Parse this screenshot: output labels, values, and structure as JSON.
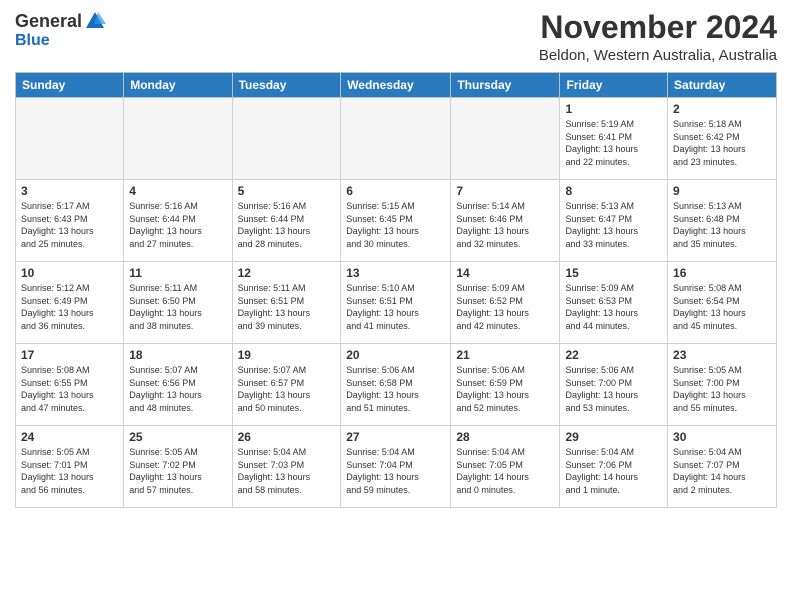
{
  "header": {
    "logo_general": "General",
    "logo_blue": "Blue",
    "month_title": "November 2024",
    "location": "Beldon, Western Australia, Australia"
  },
  "days_of_week": [
    "Sunday",
    "Monday",
    "Tuesday",
    "Wednesday",
    "Thursday",
    "Friday",
    "Saturday"
  ],
  "weeks": [
    [
      {
        "day": "",
        "info": ""
      },
      {
        "day": "",
        "info": ""
      },
      {
        "day": "",
        "info": ""
      },
      {
        "day": "",
        "info": ""
      },
      {
        "day": "",
        "info": ""
      },
      {
        "day": "1",
        "info": "Sunrise: 5:19 AM\nSunset: 6:41 PM\nDaylight: 13 hours\nand 22 minutes."
      },
      {
        "day": "2",
        "info": "Sunrise: 5:18 AM\nSunset: 6:42 PM\nDaylight: 13 hours\nand 23 minutes."
      }
    ],
    [
      {
        "day": "3",
        "info": "Sunrise: 5:17 AM\nSunset: 6:43 PM\nDaylight: 13 hours\nand 25 minutes."
      },
      {
        "day": "4",
        "info": "Sunrise: 5:16 AM\nSunset: 6:44 PM\nDaylight: 13 hours\nand 27 minutes."
      },
      {
        "day": "5",
        "info": "Sunrise: 5:16 AM\nSunset: 6:44 PM\nDaylight: 13 hours\nand 28 minutes."
      },
      {
        "day": "6",
        "info": "Sunrise: 5:15 AM\nSunset: 6:45 PM\nDaylight: 13 hours\nand 30 minutes."
      },
      {
        "day": "7",
        "info": "Sunrise: 5:14 AM\nSunset: 6:46 PM\nDaylight: 13 hours\nand 32 minutes."
      },
      {
        "day": "8",
        "info": "Sunrise: 5:13 AM\nSunset: 6:47 PM\nDaylight: 13 hours\nand 33 minutes."
      },
      {
        "day": "9",
        "info": "Sunrise: 5:13 AM\nSunset: 6:48 PM\nDaylight: 13 hours\nand 35 minutes."
      }
    ],
    [
      {
        "day": "10",
        "info": "Sunrise: 5:12 AM\nSunset: 6:49 PM\nDaylight: 13 hours\nand 36 minutes."
      },
      {
        "day": "11",
        "info": "Sunrise: 5:11 AM\nSunset: 6:50 PM\nDaylight: 13 hours\nand 38 minutes."
      },
      {
        "day": "12",
        "info": "Sunrise: 5:11 AM\nSunset: 6:51 PM\nDaylight: 13 hours\nand 39 minutes."
      },
      {
        "day": "13",
        "info": "Sunrise: 5:10 AM\nSunset: 6:51 PM\nDaylight: 13 hours\nand 41 minutes."
      },
      {
        "day": "14",
        "info": "Sunrise: 5:09 AM\nSunset: 6:52 PM\nDaylight: 13 hours\nand 42 minutes."
      },
      {
        "day": "15",
        "info": "Sunrise: 5:09 AM\nSunset: 6:53 PM\nDaylight: 13 hours\nand 44 minutes."
      },
      {
        "day": "16",
        "info": "Sunrise: 5:08 AM\nSunset: 6:54 PM\nDaylight: 13 hours\nand 45 minutes."
      }
    ],
    [
      {
        "day": "17",
        "info": "Sunrise: 5:08 AM\nSunset: 6:55 PM\nDaylight: 13 hours\nand 47 minutes."
      },
      {
        "day": "18",
        "info": "Sunrise: 5:07 AM\nSunset: 6:56 PM\nDaylight: 13 hours\nand 48 minutes."
      },
      {
        "day": "19",
        "info": "Sunrise: 5:07 AM\nSunset: 6:57 PM\nDaylight: 13 hours\nand 50 minutes."
      },
      {
        "day": "20",
        "info": "Sunrise: 5:06 AM\nSunset: 6:58 PM\nDaylight: 13 hours\nand 51 minutes."
      },
      {
        "day": "21",
        "info": "Sunrise: 5:06 AM\nSunset: 6:59 PM\nDaylight: 13 hours\nand 52 minutes."
      },
      {
        "day": "22",
        "info": "Sunrise: 5:06 AM\nSunset: 7:00 PM\nDaylight: 13 hours\nand 53 minutes."
      },
      {
        "day": "23",
        "info": "Sunrise: 5:05 AM\nSunset: 7:00 PM\nDaylight: 13 hours\nand 55 minutes."
      }
    ],
    [
      {
        "day": "24",
        "info": "Sunrise: 5:05 AM\nSunset: 7:01 PM\nDaylight: 13 hours\nand 56 minutes."
      },
      {
        "day": "25",
        "info": "Sunrise: 5:05 AM\nSunset: 7:02 PM\nDaylight: 13 hours\nand 57 minutes."
      },
      {
        "day": "26",
        "info": "Sunrise: 5:04 AM\nSunset: 7:03 PM\nDaylight: 13 hours\nand 58 minutes."
      },
      {
        "day": "27",
        "info": "Sunrise: 5:04 AM\nSunset: 7:04 PM\nDaylight: 13 hours\nand 59 minutes."
      },
      {
        "day": "28",
        "info": "Sunrise: 5:04 AM\nSunset: 7:05 PM\nDaylight: 14 hours\nand 0 minutes."
      },
      {
        "day": "29",
        "info": "Sunrise: 5:04 AM\nSunset: 7:06 PM\nDaylight: 14 hours\nand 1 minute."
      },
      {
        "day": "30",
        "info": "Sunrise: 5:04 AM\nSunset: 7:07 PM\nDaylight: 14 hours\nand 2 minutes."
      }
    ]
  ]
}
